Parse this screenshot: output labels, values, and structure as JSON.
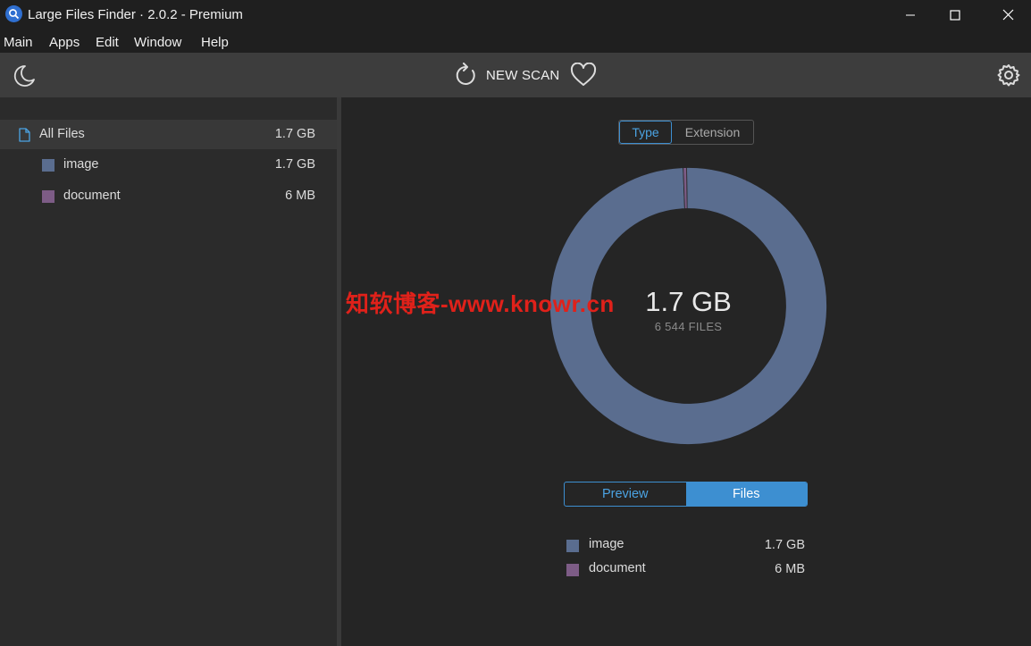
{
  "window": {
    "title": "Large Files Finder · 2.0.2 - Premium",
    "icon": "magnifier-icon",
    "controls": [
      "minimize-icon",
      "maximize-icon",
      "close-icon"
    ]
  },
  "menu": [
    "Main",
    "Apps",
    "Edit",
    "Window",
    "Help"
  ],
  "toolbar": {
    "theme_icon": "moon-icon",
    "scan_icon": "refresh-icon",
    "scan_label": "NEW SCAN",
    "favorite_icon": "heart-icon",
    "settings_icon": "gear-icon"
  },
  "sidebar": {
    "root": {
      "label": "All Files",
      "size": "1.7 GB",
      "icon": "file-icon"
    },
    "items": [
      {
        "label": "image",
        "size": "1.7 GB",
        "color": "#5a6d8f"
      },
      {
        "label": "document",
        "size": "6 MB",
        "color": "#7d5c86"
      }
    ]
  },
  "main": {
    "group_by": {
      "options": [
        "Type",
        "Extension"
      ],
      "selected": "Type"
    },
    "total_size": "1.7 GB",
    "total_files": "6 544 FILES",
    "view_mode": {
      "options": [
        "Preview",
        "Files"
      ],
      "selected": "Files"
    },
    "legend": [
      {
        "label": "image",
        "size": "1.7 GB",
        "color": "#5a6d8f"
      },
      {
        "label": "document",
        "size": "6 MB",
        "color": "#7d5c86"
      }
    ]
  },
  "chart_data": {
    "type": "pie",
    "categories": [
      "image",
      "document"
    ],
    "values": [
      1740.8,
      6
    ],
    "colors": [
      "#5a6d8f",
      "#7d5c86"
    ],
    "unit": "MB"
  },
  "watermark": "知软博客-www.knowr.cn",
  "colors": {
    "accent": "#3d8fd1",
    "image": "#5a6d8f",
    "document": "#7d5c86"
  }
}
